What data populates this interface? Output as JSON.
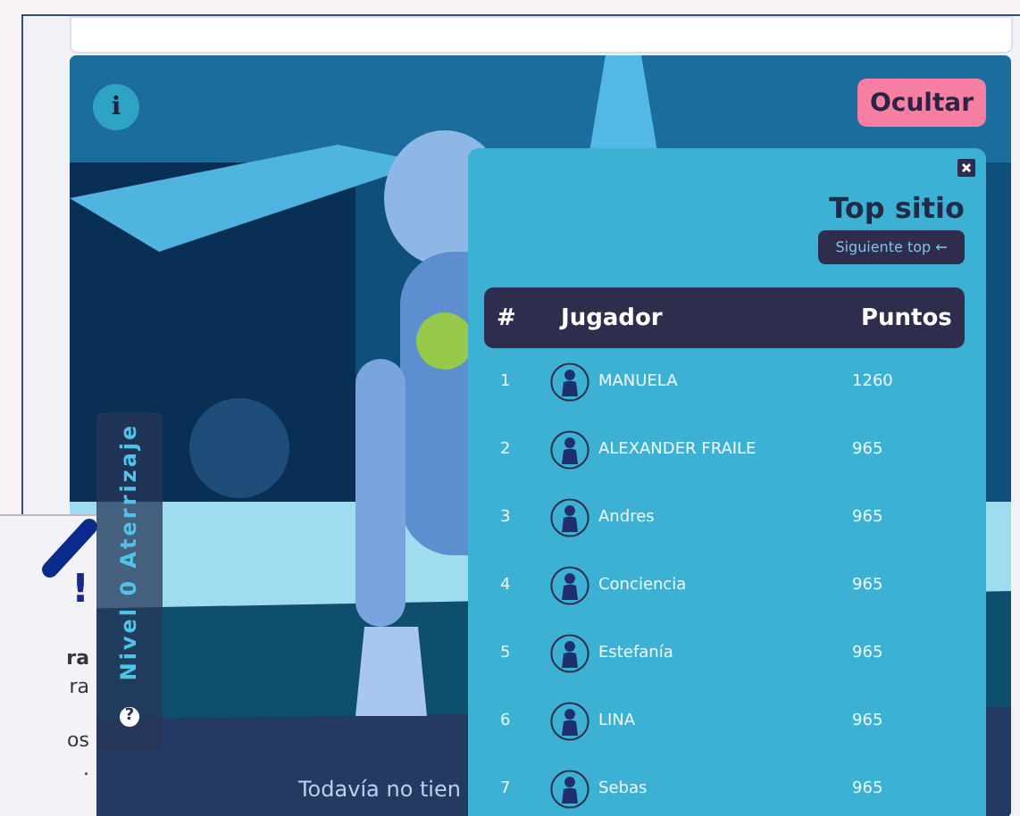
{
  "info_button": {
    "label": "i"
  },
  "hide_button": {
    "label": "Ocultar"
  },
  "level_tab": {
    "label": "Nivel 0 Aterrizaje",
    "help": "?"
  },
  "footer_text": "Todavía no tien",
  "ranking": {
    "title": "Top sitio",
    "next_button": "Siguiente top ←",
    "columns": [
      "#",
      "Jugador",
      "Puntos"
    ],
    "rows": [
      {
        "rank": "1",
        "name": "MANUELA",
        "points": "1260"
      },
      {
        "rank": "2",
        "name": "ALEXANDER FRAILE",
        "points": "965"
      },
      {
        "rank": "3",
        "name": "Andres",
        "points": "965"
      },
      {
        "rank": "4",
        "name": "Conciencia",
        "points": "965"
      },
      {
        "rank": "5",
        "name": "Estefanía",
        "points": "965"
      },
      {
        "rank": "6",
        "name": "LINA",
        "points": "965"
      },
      {
        "rank": "7",
        "name": "Sebas",
        "points": "965"
      }
    ]
  },
  "side_popup": {
    "lines": [
      {
        "kind": "heading",
        "text": "!"
      },
      {
        "kind": "bold",
        "text": "ra"
      },
      {
        "kind": "text",
        "text": "ra"
      },
      {
        "kind": "text",
        "text": "os"
      },
      {
        "kind": "text",
        "text": "."
      }
    ]
  }
}
